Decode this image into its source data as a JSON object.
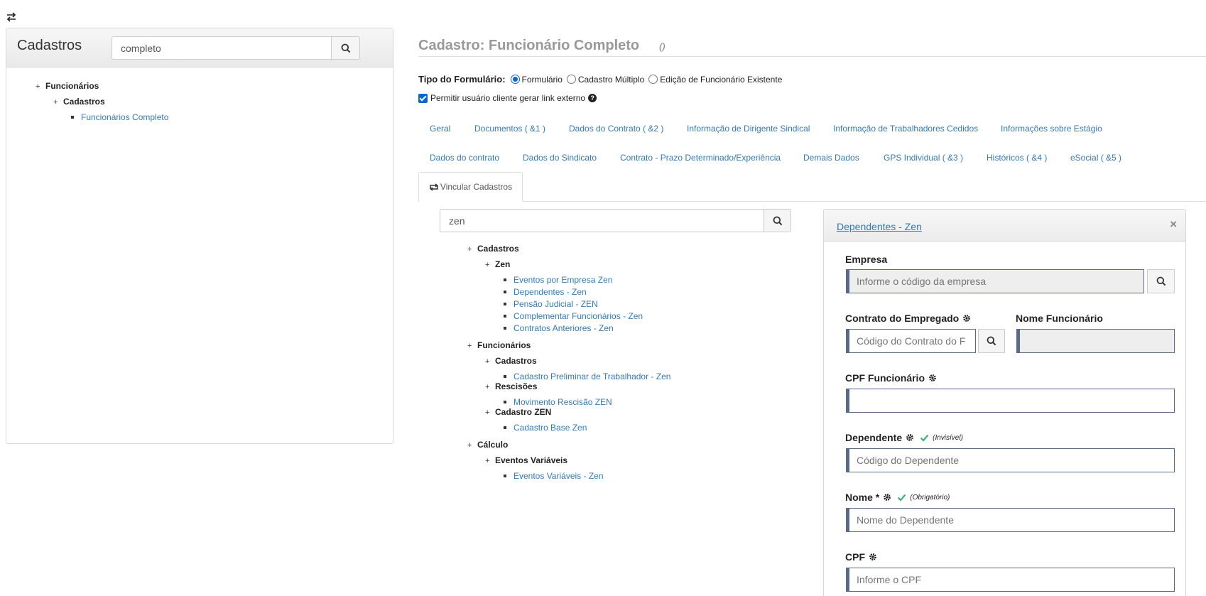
{
  "left_panel": {
    "title": "Cadastros",
    "search_value": "completo",
    "tree": {
      "root": "Funcionários",
      "child": "Cadastros",
      "leaf": "Funcionários Completo"
    }
  },
  "header": {
    "title": "Cadastro: Funcionário Completo",
    "paren": "()"
  },
  "form_type": {
    "label": "Tipo do Formulário:",
    "options": [
      "Formulário",
      "Cadastro Múltiplo",
      "Edição de Funcionário Existente"
    ],
    "selected": "Formulário"
  },
  "external_link": {
    "label": "Permitir usuário cliente gerar link externo",
    "checked": true
  },
  "tabs_row1": [
    "Geral",
    "Documentos ( &1 )",
    "Dados do Contrato ( &2 )",
    "Informação de Dirigente Sindical",
    "Informação de Trabalhadores Cedidos",
    "Informações sobre Estágio"
  ],
  "tabs_row2": [
    "Dados do contrato",
    "Dados do Sindicato",
    "Contrato - Prazo Determinado/Experiência",
    "Demais Dados",
    "GPS Individual ( &3 )",
    "Históricos ( &4 )",
    "eSocial ( &5 )"
  ],
  "active_tab": "Vincular Cadastros",
  "inner_search_value": "zen",
  "inner_tree": {
    "cadastros": "Cadastros",
    "zen": "Zen",
    "zen_items": [
      "Eventos por Empresa Zen",
      "Dependentes - Zen",
      "Pensão Judicial - ZEN",
      "Complementar Funcionários - Zen",
      "Contratos Anteriores - Zen"
    ],
    "funcionarios": "Funcionários",
    "func_cadastros": "Cadastros",
    "func_cadastros_item": "Cadastro Preliminar de Trabalhador - Zen",
    "rescisoes": "Rescisões",
    "rescisoes_item": "Movimento Rescisão ZEN",
    "cadastro_zen": "Cadastro ZEN",
    "cadastro_zen_item": "Cadastro Base Zen",
    "calculo": "Cálculo",
    "eventos_variaveis": "Eventos Variáveis",
    "eventos_variaveis_item": "Eventos Variáveis - Zen"
  },
  "dep_panel": {
    "title": "Dependentes - Zen",
    "close": "×",
    "empresa_label": "Empresa",
    "empresa_placeholder": "Informe o código da empresa",
    "contrato_label": "Contrato do Empregado",
    "contrato_placeholder": "Código do Contrato do F",
    "nome_func_label": "Nome Funcionário",
    "cpf_func_label": "CPF Funcionário",
    "dependente_label": "Dependente",
    "dependente_hint": "(Invisível)",
    "dependente_placeholder": "Código do Dependente",
    "nome_label": "Nome *",
    "nome_hint": "(Obrigatório)",
    "nome_placeholder": "Nome do Dependente",
    "cpf_label": "CPF",
    "cpf_placeholder": "Informe o CPF"
  },
  "colors": {
    "link": "#337ab7",
    "check_green": "#3cb371",
    "field_border": "#5a6a86"
  }
}
